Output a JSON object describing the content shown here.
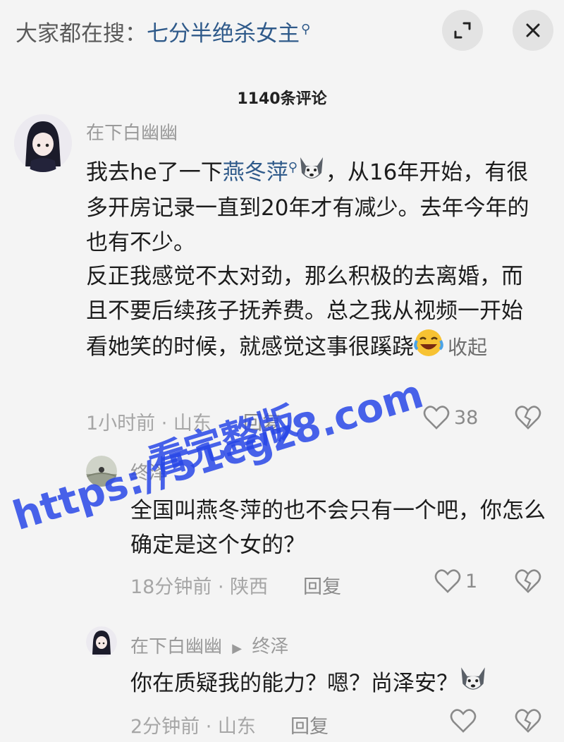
{
  "search_hint": {
    "prefix": "大家都在搜：",
    "term": "七分半绝杀女主",
    "icon": "search-icon"
  },
  "top_buttons": {
    "expand_icon": "expand-icon",
    "close_icon": "close-icon"
  },
  "comments_title": "1140条评论",
  "comments": [
    {
      "author": "在下白幽幽",
      "text_before_link": "我去he了一下",
      "link_text": "燕冬萍",
      "text_after_link": "，从16年开始，有很多开房记录一直到20年才有减少。去年今年的也有不少。",
      "paragraph2": "反正我感觉不太对劲，那么积极的去离婚，而且不要后续孩子抚养费。总之我从视频一开始看她笑的时候，就感觉这事很蹊跷",
      "collapse_label": "收起",
      "time_location": "1小时前 · 山东",
      "reply_label": "回复",
      "likes": "38"
    }
  ],
  "replies": [
    {
      "author": "终泽",
      "text": "全国叫燕冬萍的也不会只有一个吧，你怎么确定是这个女的？",
      "time_location": "18分钟前 · 陕西",
      "reply_label": "回复",
      "likes": "1"
    },
    {
      "author": "在下白幽幽",
      "reply_to": "终泽",
      "text": "你在质疑我的能力？嗯？尚泽安？",
      "time_location": "2分钟前 · 山东",
      "reply_label": "回复",
      "likes": ""
    }
  ],
  "watermark": {
    "line1": "https://51cgz8.com",
    "line2": "看完整版"
  },
  "colors": {
    "link": "#2f5a8a",
    "watermark": "#2846e6",
    "background": "#f4f4f4"
  }
}
